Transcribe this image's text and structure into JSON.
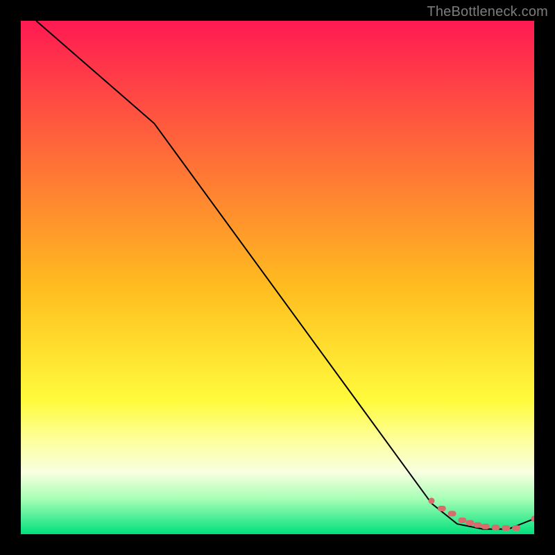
{
  "watermark": "TheBottleneck.com",
  "chart_data": {
    "type": "line",
    "title": "",
    "xlabel": "",
    "ylabel": "",
    "xlim": [
      0,
      100
    ],
    "ylim": [
      0,
      100
    ],
    "grid": false,
    "legend": false,
    "background_gradient": {
      "type": "vertical",
      "stops": [
        {
          "t": 0.0,
          "color": "#ff1a52"
        },
        {
          "t": 0.52,
          "color": "#ffbd1f"
        },
        {
          "t": 0.74,
          "color": "#fffb3c"
        },
        {
          "t": 0.82,
          "color": "#fdffa0"
        },
        {
          "t": 0.88,
          "color": "#f7ffe0"
        },
        {
          "t": 0.93,
          "color": "#a9ffb6"
        },
        {
          "t": 1.0,
          "color": "#00e07d"
        }
      ]
    },
    "series": [
      {
        "name": "curve",
        "style": "black-line",
        "x": [
          3,
          26,
          80,
          85,
          90,
          95,
          100
        ],
        "y": [
          100,
          80,
          6,
          2,
          1,
          1,
          3
        ]
      },
      {
        "name": "dash-markers",
        "style": "salmon-dots",
        "x": [
          80,
          82,
          84,
          86,
          87.5,
          89,
          90.5,
          92.5,
          94.5,
          96.5,
          100
        ],
        "y": [
          6.5,
          5,
          4,
          2.7,
          2.2,
          1.8,
          1.5,
          1.3,
          1.2,
          1.2,
          3
        ]
      }
    ]
  }
}
